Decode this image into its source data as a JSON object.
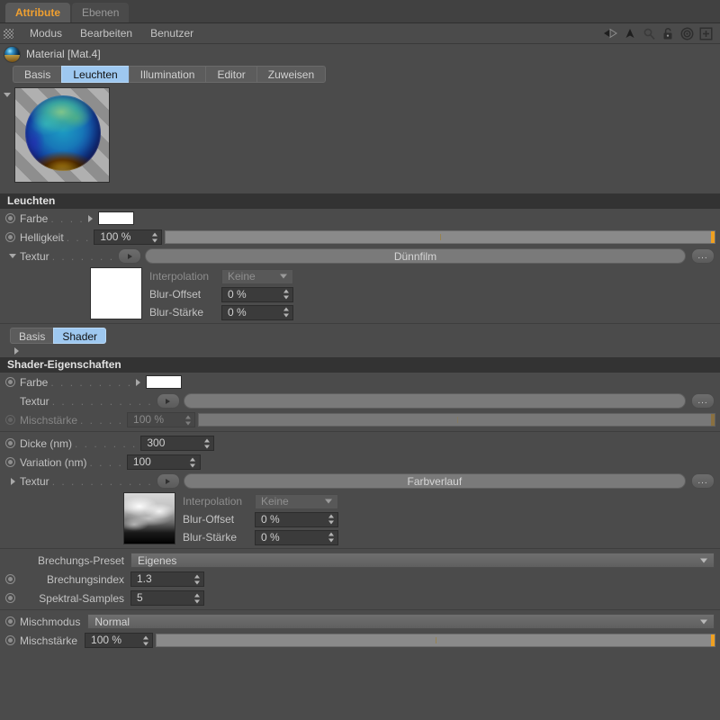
{
  "window_tabs": [
    {
      "label": "Attribute",
      "active": true
    },
    {
      "label": "Ebenen",
      "active": false
    }
  ],
  "menu": {
    "grip_icon": "grip-dots-icon",
    "items": [
      "Modus",
      "Bearbeiten",
      "Benutzer"
    ],
    "tools": [
      "back-arrow-icon",
      "forward-arrow-icon",
      "up-arrow-icon",
      "search-icon",
      "lock-icon",
      "target-icon",
      "plus-icon"
    ]
  },
  "material": {
    "icon": "material-sphere-icon",
    "title": "Material [Mat.4]",
    "tabs": [
      {
        "label": "Basis",
        "active": false
      },
      {
        "label": "Leuchten",
        "active": true
      },
      {
        "label": "Illumination",
        "active": false
      },
      {
        "label": "Editor",
        "active": false
      },
      {
        "label": "Zuweisen",
        "active": false
      }
    ]
  },
  "leuchten": {
    "header": "Leuchten",
    "farbe": {
      "label": "Farbe",
      "dots": ". . . .",
      "color": "#ffffff"
    },
    "helligkeit": {
      "label": "Helligkeit",
      "dots": ". . .",
      "value": "100 %",
      "slider_percent": 100
    },
    "textur": {
      "label": "Textur",
      "dots": ". . . . . . .",
      "value": "Dünnfilm",
      "more_label": "...",
      "interpolation": {
        "label": "Interpolation",
        "value": "Keine"
      },
      "blur_offset": {
        "label": "Blur-Offset",
        "value": "0 %"
      },
      "blur_staerke": {
        "label": "Blur-Stärke",
        "value": "0 %"
      }
    }
  },
  "shader_tabs": [
    {
      "label": "Basis",
      "active": false
    },
    {
      "label": "Shader",
      "active": true
    }
  ],
  "shader": {
    "header": "Shader-Eigenschaften",
    "farbe": {
      "label": "Farbe",
      "dots": ". . . . . . . . .",
      "color": "#ffffff"
    },
    "textur": {
      "label": "Textur",
      "dots": ". . . . . . . . . . .",
      "value": "",
      "more_label": "..."
    },
    "mischstaerke": {
      "label": "Mischstärke",
      "dots": ". . . . .",
      "value": "100 %",
      "slider_percent": 100,
      "disabled": true
    },
    "dicke": {
      "label": "Dicke (nm)",
      "dots": ". . . . . . .",
      "value": "300"
    },
    "variation": {
      "label": "Variation (nm)",
      "dots": ". . . .",
      "value": "100"
    },
    "textur2": {
      "label": "Textur",
      "dots": ". . . . . . . . . . .",
      "value": "Farbverlauf",
      "more_label": "...",
      "interpolation": {
        "label": "Interpolation",
        "value": "Keine"
      },
      "blur_offset": {
        "label": "Blur-Offset",
        "value": "0 %"
      },
      "blur_staerke": {
        "label": "Blur-Stärke",
        "value": "0 %"
      }
    },
    "brechungs_preset": {
      "label": "Brechungs-Preset",
      "value": "Eigenes"
    },
    "brechungsindex": {
      "label": "Brechungsindex",
      "value": "1.3"
    },
    "spektral_samples": {
      "label": "Spektral-Samples",
      "value": "5"
    }
  },
  "mischung": {
    "mischmodus": {
      "label": "Mischmodus",
      "value": "Normal"
    },
    "mischstaerke": {
      "label": "Mischstärke",
      "value": "100 %",
      "slider_percent": 100
    }
  },
  "colors": {
    "accent_orange": "#f0a030",
    "tab_active_blue": "#9ec8f0",
    "panel_bg": "#4b4b4b",
    "section_bg": "#333333",
    "field_bg": "#3b3b3b"
  }
}
